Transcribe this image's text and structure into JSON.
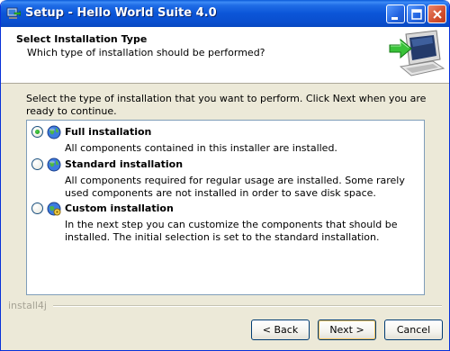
{
  "window": {
    "title": "Setup - Hello World Suite 4.0",
    "minimize_icon": "minimize-icon",
    "maximize_icon": "maximize-icon",
    "close_icon": "close-icon"
  },
  "header": {
    "title": "Select Installation Type",
    "subtitle": "Which type of installation should be performed?",
    "graphic_icon": "computer-install-arrow-icon"
  },
  "instructions": "Select the type of installation that you want to perform. Click Next when you are ready to continue.",
  "options": [
    {
      "title": "Full installation",
      "description": "All components contained in this installer are installed.",
      "icon": "globe-icon",
      "selected": true
    },
    {
      "title": "Standard installation",
      "description": "All components required for regular usage are installed. Some rarely used components are not installed in order to save disk space.",
      "icon": "globe-icon",
      "selected": false
    },
    {
      "title": "Custom installation",
      "description": "In the next step you can customize the components that should be installed. The initial selection is set to the standard installation.",
      "icon": "globe-gear-icon",
      "selected": false
    }
  ],
  "brand": "install4j",
  "buttons": {
    "back": "< Back",
    "next": "Next >",
    "cancel": "Cancel"
  },
  "colors": {
    "titlebar": "#0a55d8",
    "face": "#ece9d8",
    "radio_selected": "#21a121"
  }
}
